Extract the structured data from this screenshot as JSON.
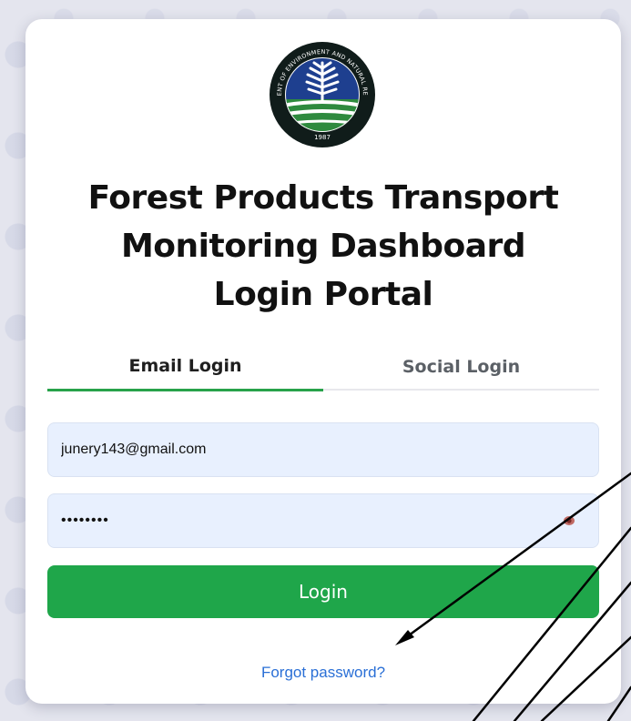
{
  "logo": {
    "arc_top": "DEPARTMENT OF ENVIRONMENT AND NATURAL RESOURCES",
    "year": "1987",
    "colors": {
      "ring": "#101c1a",
      "sky": "#1e3f8f",
      "leaf": "#ffffff",
      "land": "#2e8a3e"
    }
  },
  "title_lines": [
    "Forest Products Transport",
    "Monitoring Dashboard",
    "Login Portal"
  ],
  "tabs": [
    {
      "label": "Email Login",
      "active": true
    },
    {
      "label": "Social Login",
      "active": false
    }
  ],
  "form": {
    "email_value": "junery143@gmail.com",
    "password_value": "••••••••",
    "password_toggle_icon": "eye-icon"
  },
  "login_button": {
    "label": "Login"
  },
  "forgot_link": {
    "label": "Forgot password?"
  },
  "colors": {
    "accent_green": "#1fa64a",
    "link_blue": "#2a6fd6",
    "input_bg": "#e8f0fe",
    "background": "#e4e5ee"
  }
}
